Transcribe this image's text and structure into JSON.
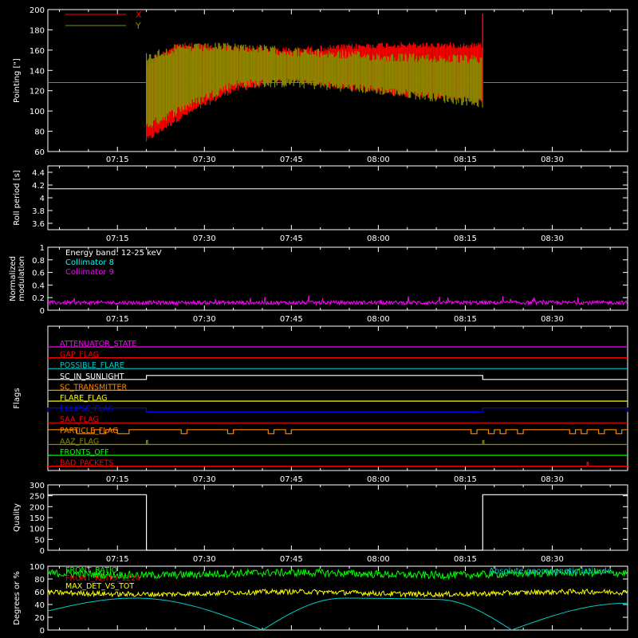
{
  "time_axis": {
    "start": "07:03",
    "end": "08:43",
    "tick_labels": [
      "07:15",
      "07:30",
      "07:45",
      "08:00",
      "08:15",
      "08:30"
    ]
  },
  "colors": {
    "background": "#000000",
    "axes": "#ffffff",
    "x_series": "#ff0000",
    "y_series": "#8a8a00",
    "collimator8": "#00ffff",
    "collimator9": "#ff00ff",
    "front_ratio": "#00ff00",
    "max_det": "#ffff00",
    "latitude": "#00cccc"
  },
  "chart_data": [
    {
      "id": "pointing",
      "type": "line",
      "ylabel": "Pointing [\"]",
      "ylim": [
        60,
        200
      ],
      "yticks": [
        60,
        80,
        100,
        120,
        140,
        160,
        180,
        200
      ],
      "legend": {
        "placement": "top-left",
        "entries": [
          {
            "label": "X",
            "color": "#ff0000"
          },
          {
            "label": "Y",
            "color": "#8a8a00"
          }
        ]
      },
      "series": [
        {
          "name": "X",
          "color": "#ff0000",
          "x": [
            "07:20",
            "07:25",
            "07:35",
            "07:45",
            "08:00",
            "08:18"
          ],
          "upper": [
            148,
            168,
            165,
            163,
            168,
            168
          ],
          "lower": [
            68,
            88,
            118,
            128,
            116,
            108
          ]
        },
        {
          "name": "Y",
          "color": "#8a8a00",
          "x": [
            "07:20",
            "07:25",
            "07:35",
            "07:45",
            "08:00",
            "08:18"
          ],
          "upper": [
            158,
            166,
            168,
            163,
            158,
            155
          ],
          "lower": [
            80,
            95,
            122,
            123,
            116,
            103
          ]
        }
      ],
      "reference_line": 128
    },
    {
      "id": "roll",
      "type": "line",
      "ylabel": "Roll period [s]",
      "ylim": [
        3.5,
        4.5
      ],
      "yticks": [
        3.6,
        3.8,
        4.0,
        4.2,
        4.4
      ],
      "series": [
        {
          "name": "",
          "color": "#ffffff",
          "x": [
            "07:03",
            "08:43"
          ],
          "values": [
            4.14,
            4.14
          ]
        }
      ]
    },
    {
      "id": "modulation",
      "type": "line",
      "ylabel": "Normalized modulation",
      "ylim": [
        0,
        1.0
      ],
      "yticks": [
        0.0,
        0.2,
        0.4,
        0.6,
        0.8,
        1.0
      ],
      "legend": {
        "placement": "top-left",
        "entries": [
          {
            "label": "Energy band: 12-25 keV",
            "color": "#ffffff"
          },
          {
            "label": "Collimator 8",
            "color": "#00ffff"
          },
          {
            "label": "Collimator 9",
            "color": "#ff00ff"
          }
        ]
      },
      "series": [
        {
          "name": "Collimator 9",
          "color": "#ff00ff",
          "mean": 0.12,
          "spread": 0.03
        }
      ]
    },
    {
      "id": "flags",
      "type": "line",
      "ylabel": "Flags",
      "rows": [
        {
          "label": "ATTENUATOR_STATE",
          "color": "#ff00ff",
          "high": []
        },
        {
          "label": "GAP_FLAG",
          "color": "#ff0000",
          "high": []
        },
        {
          "label": "POSSIBLE_FLARE",
          "color": "#00cccc",
          "high": []
        },
        {
          "label": "SC_IN_SUNLIGHT",
          "color": "#ffffff",
          "high": [
            [
              "07:20",
              "08:18"
            ]
          ]
        },
        {
          "label": "SC_TRANSMITTER",
          "color": "#ff8800",
          "high": []
        },
        {
          "label": "FLARE_FLAG",
          "color": "#ffff00",
          "high": []
        },
        {
          "label": "ECLIPSE_FLAG",
          "color": "#0000ff",
          "high": [
            [
              "07:03",
              "07:20"
            ],
            [
              "08:18",
              "08:43"
            ]
          ]
        },
        {
          "label": "SAA_FLAG",
          "color": "#ff0000",
          "high": []
        },
        {
          "label": "PARTICLE_FLAG",
          "color": "#ff8800",
          "toggles": true
        },
        {
          "label": "AAZ_FLAG",
          "color": "#8a8a00",
          "high": [
            [
              "07:20",
              "07:20"
            ],
            [
              "08:18",
              "08:18"
            ]
          ]
        },
        {
          "label": "FRONTS_OFF",
          "color": "#00ff00",
          "high": []
        },
        {
          "label": "BAD_PACKETS",
          "color": "#ff0000",
          "high": [
            [
              "08:36",
              "08:36"
            ]
          ]
        }
      ]
    },
    {
      "id": "quality",
      "type": "line",
      "ylabel": "Quality",
      "ylim": [
        0,
        300
      ],
      "yticks": [
        0,
        50,
        100,
        150,
        200,
        250,
        300
      ],
      "series": [
        {
          "name": "",
          "color": "#ffffff",
          "x": [
            "07:03",
            "07:20",
            "07:20",
            "08:18",
            "08:18",
            "08:43"
          ],
          "values": [
            255,
            255,
            0,
            0,
            255,
            255
          ]
        }
      ]
    },
    {
      "id": "geo",
      "type": "line",
      "ylabel": "Degrees or %",
      "ylim": [
        0,
        100
      ],
      "yticks": [
        0,
        20,
        40,
        60,
        80,
        100
      ],
      "legend": {
        "placement": "top",
        "entries": [
          {
            "label": "FRONT_RATIO",
            "color": "#00ff00"
          },
          {
            "label": "FRONT_RATIO_1224",
            "color": "#ff0000"
          },
          {
            "label": "MAX_DET_VS_TOT",
            "color": "#ffff00"
          },
          {
            "label": "Absolute geomagnetic latitude",
            "color": "#00cccc"
          }
        ]
      },
      "series": [
        {
          "name": "FRONT_RATIO",
          "color": "#00ff00",
          "mean": 88,
          "spread": 6
        },
        {
          "name": "MAX_DET_VS_TOT",
          "color": "#ffff00",
          "mean": 58,
          "spread": 4
        },
        {
          "name": "Absolute geomagnetic latitude",
          "color": "#00cccc",
          "x": [
            "07:03",
            "07:18",
            "07:40",
            "07:54",
            "08:10",
            "08:23",
            "08:43"
          ],
          "values": [
            30,
            50,
            0,
            50,
            48,
            0,
            42
          ]
        }
      ]
    }
  ]
}
